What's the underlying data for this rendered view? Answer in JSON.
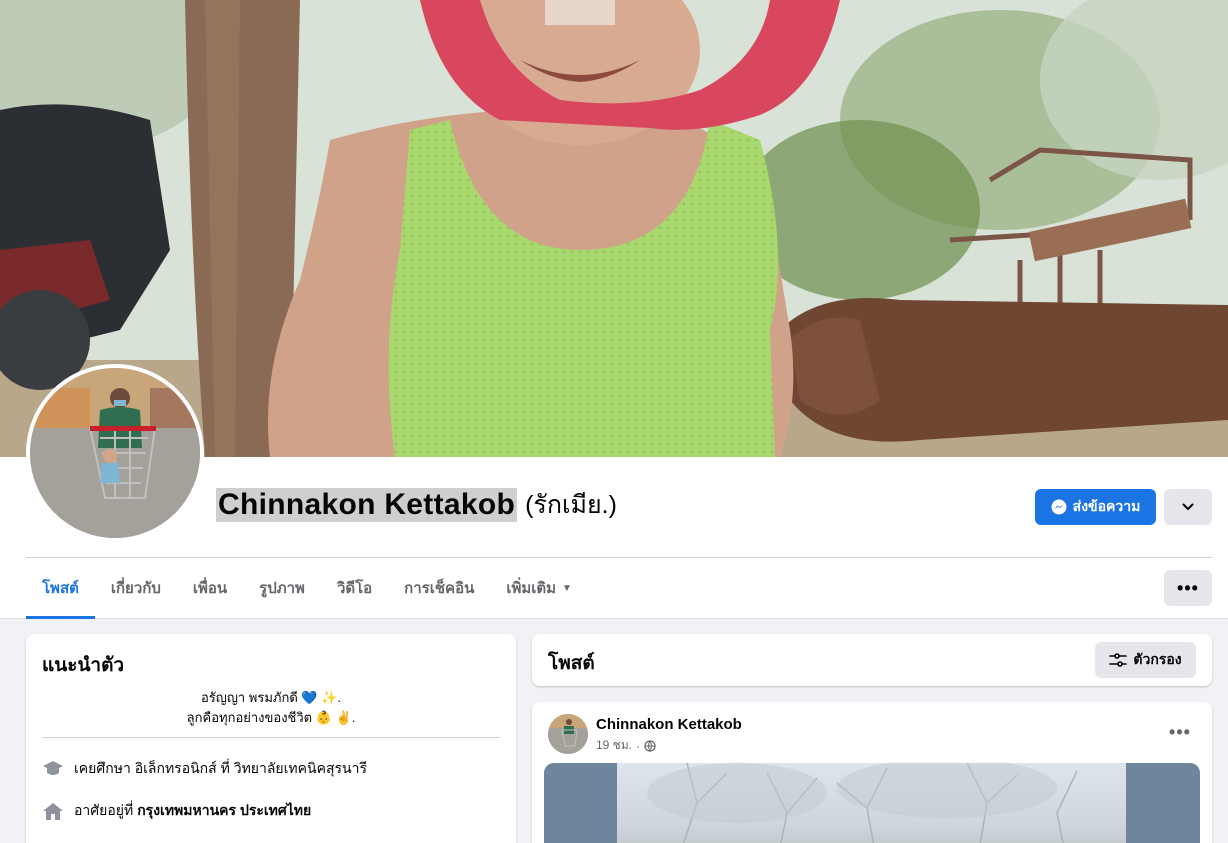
{
  "profile": {
    "name": "Chinnakon Kettakob",
    "alternate_name": "(รักเมีย.)"
  },
  "actions": {
    "message_label": "ส่งข้อความ",
    "dropdown_icon": "chevron-down-icon"
  },
  "tabs": [
    {
      "label": "โพสต์",
      "active": true
    },
    {
      "label": "เกี่ยวกับ"
    },
    {
      "label": "เพื่อน"
    },
    {
      "label": "รูปภาพ"
    },
    {
      "label": "วิดีโอ"
    },
    {
      "label": "การเช็คอิน"
    },
    {
      "label": "เพิ่มเติม",
      "caret": "▼"
    }
  ],
  "intro": {
    "title": "แนะนำตัว",
    "bio_line1": "อรัญญา พรมภักดี 💙 ✨.",
    "bio_line2": "ลูกคือทุกอย่างของชีวิต 👶 ✌️.",
    "education_text": "เคยศึกษา อิเล็กทรอนิกส์ ที่ วิทยาลัยเทคนิคสุรนารี",
    "lives_prefix": "อาศัยอยู่ที่",
    "lives_location": "กรุงเทพมหานคร ประเทศไทย"
  },
  "posts_section": {
    "title": "โพสต์",
    "filter_label": "ตัวกรอง"
  },
  "post": {
    "author": "Chinnakon Kettakob",
    "time": "19 ชม.",
    "separator": "·",
    "privacy_icon": "globe-icon"
  },
  "colors": {
    "accent": "#1b74e4",
    "page_bg": "#f0f2f5",
    "secondary_button": "#e4e6eb",
    "secondary_text": "#65676b"
  }
}
